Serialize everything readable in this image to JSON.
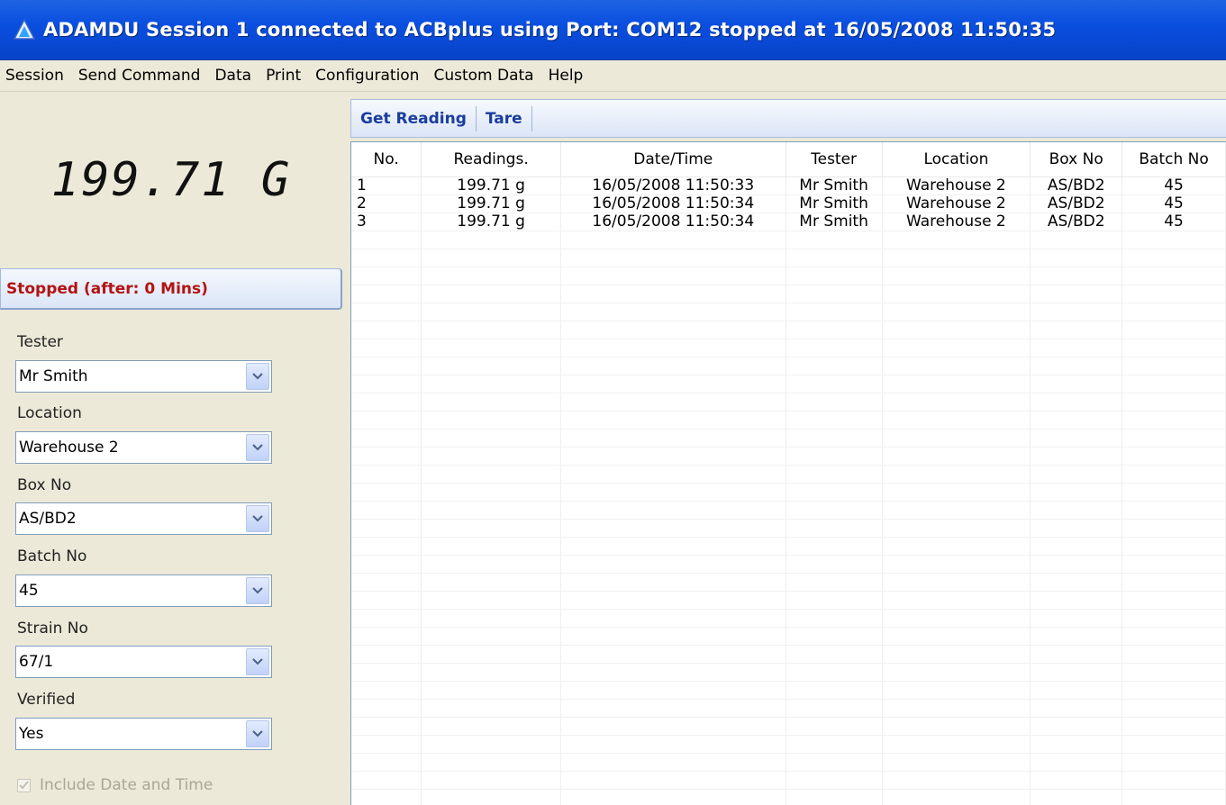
{
  "window": {
    "title": "ADAMDU Session 1 connected to ACBplus using Port: COM12 stopped at 16/05/2008 11:50:35"
  },
  "menu": [
    "Session",
    "Send Command",
    "Data",
    "Print",
    "Configuration",
    "Custom Data",
    "Help"
  ],
  "display": {
    "reading": "199.71 G"
  },
  "status": {
    "text": "Stopped (after: 0 Mins)"
  },
  "fields": [
    {
      "label": "Tester",
      "value": "Mr Smith"
    },
    {
      "label": "Location",
      "value": "Warehouse 2"
    },
    {
      "label": "Box No",
      "value": "AS/BD2"
    },
    {
      "label": "Batch No",
      "value": "45"
    },
    {
      "label": "Strain No",
      "value": "67/1"
    },
    {
      "label": "Verified",
      "value": "Yes"
    }
  ],
  "include_datetime": {
    "label": "Include Date and Time",
    "checked": true,
    "enabled": false
  },
  "toolbar": {
    "get_reading_label": "Get Reading",
    "tare_label": "Tare"
  },
  "table": {
    "columns": [
      "No.",
      "Readings.",
      "Date/Time",
      "Tester",
      "Location",
      "Box No",
      "Batch No"
    ],
    "rows": [
      [
        "1",
        "199.71 g",
        "16/05/2008 11:50:33",
        "Mr Smith",
        "Warehouse 2",
        "AS/BD2",
        "45"
      ],
      [
        "2",
        "199.71 g",
        "16/05/2008 11:50:34",
        "Mr Smith",
        "Warehouse 2",
        "AS/BD2",
        "45"
      ],
      [
        "3",
        "199.71 g",
        "16/05/2008 11:50:34",
        "Mr Smith",
        "Warehouse 2",
        "AS/BD2",
        "45"
      ]
    ]
  },
  "colors": {
    "title_bar": "#0a4fe0",
    "status_text": "#b31313",
    "toolbar_text": "#1a3d9e",
    "window_bg": "#ECE9D8"
  }
}
